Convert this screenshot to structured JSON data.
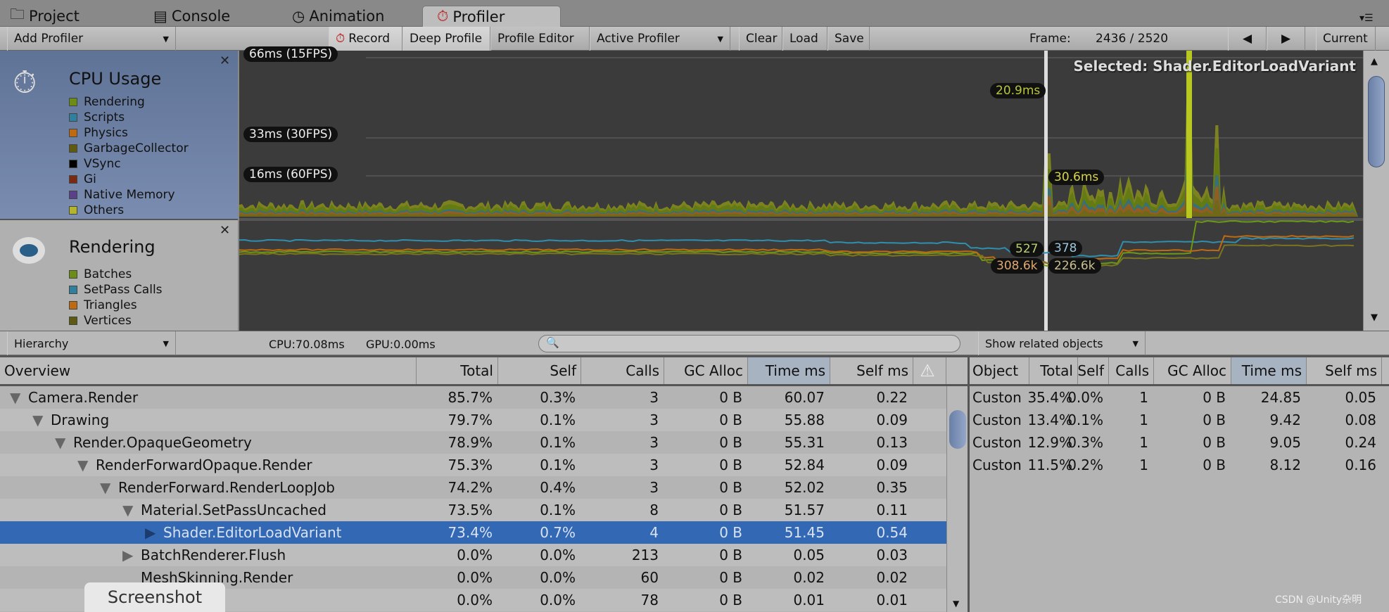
{
  "tabs": [
    {
      "label": "Project",
      "icon": "folder-icon"
    },
    {
      "label": "Console",
      "icon": "console-icon"
    },
    {
      "label": "Animation",
      "icon": "clock-icon"
    },
    {
      "label": "Profiler",
      "icon": "stopwatch-icon",
      "active": true
    }
  ],
  "toolbar": {
    "add_profiler": "Add Profiler",
    "record": "Record",
    "deep_profile": "Deep Profile",
    "profile_editor": "Profile Editor",
    "active_profiler": "Active Profiler",
    "clear": "Clear",
    "load": "Load",
    "save": "Save",
    "frame_label": "Frame:",
    "frame_value": "2436 / 2520",
    "current": "Current"
  },
  "cpu": {
    "title": "CPU Usage",
    "legend": [
      {
        "label": "Rendering",
        "color": "#6b8e12"
      },
      {
        "label": "Scripts",
        "color": "#2f7f9f"
      },
      {
        "label": "Physics",
        "color": "#c06a10"
      },
      {
        "label": "GarbageCollector",
        "color": "#5e5a10"
      },
      {
        "label": "VSync",
        "color": "#000000"
      },
      {
        "label": "Gi",
        "color": "#7a2a10"
      },
      {
        "label": "Native Memory",
        "color": "#5a3f8a"
      },
      {
        "label": "Others",
        "color": "#b3b52a"
      }
    ],
    "lines": [
      "66ms (15FPS)",
      "33ms (30FPS)",
      "16ms (60FPS)"
    ],
    "selected": "Selected: Shader.EditorLoadVariant",
    "value_a": "20.9ms",
    "value_b": "30.6ms"
  },
  "rendering": {
    "title": "Rendering",
    "legend": [
      {
        "label": "Batches",
        "color": "#6b8e12"
      },
      {
        "label": "SetPass Calls",
        "color": "#2f7f9f"
      },
      {
        "label": "Triangles",
        "color": "#c06a10"
      },
      {
        "label": "Vertices",
        "color": "#5e5a10"
      }
    ],
    "values": {
      "batches": "527",
      "setpass": "378",
      "triangles": "308.6k",
      "vertices": "226.6k"
    }
  },
  "hierarchy": {
    "mode": "Hierarchy",
    "cpu": "CPU:70.08ms",
    "gpu": "GPU:0.00ms",
    "search_placeholder": "",
    "related": "Show related objects",
    "columns": [
      "Overview",
      "Total",
      "Self",
      "Calls",
      "GC Alloc",
      "Time ms",
      "Self ms"
    ],
    "rows": [
      {
        "name": "Camera.Render",
        "depth": 0,
        "arrow": "down",
        "total": "85.7%",
        "self": "0.3%",
        "calls": "3",
        "gc": "0 B",
        "time": "60.07",
        "selfms": "0.22"
      },
      {
        "name": "Drawing",
        "depth": 1,
        "arrow": "down",
        "total": "79.7%",
        "self": "0.1%",
        "calls": "3",
        "gc": "0 B",
        "time": "55.88",
        "selfms": "0.09"
      },
      {
        "name": "Render.OpaqueGeometry",
        "depth": 2,
        "arrow": "down",
        "total": "78.9%",
        "self": "0.1%",
        "calls": "3",
        "gc": "0 B",
        "time": "55.31",
        "selfms": "0.13"
      },
      {
        "name": "RenderForwardOpaque.Render",
        "depth": 3,
        "arrow": "down",
        "total": "75.3%",
        "self": "0.1%",
        "calls": "3",
        "gc": "0 B",
        "time": "52.84",
        "selfms": "0.09"
      },
      {
        "name": "RenderForward.RenderLoopJob",
        "depth": 4,
        "arrow": "down",
        "total": "74.2%",
        "self": "0.4%",
        "calls": "3",
        "gc": "0 B",
        "time": "52.02",
        "selfms": "0.35"
      },
      {
        "name": "Material.SetPassUncached",
        "depth": 5,
        "arrow": "down",
        "total": "73.5%",
        "self": "0.1%",
        "calls": "8",
        "gc": "0 B",
        "time": "51.57",
        "selfms": "0.11"
      },
      {
        "name": "Shader.EditorLoadVariant",
        "depth": 6,
        "arrow": "right",
        "selected": true,
        "total": "73.4%",
        "self": "0.7%",
        "calls": "4",
        "gc": "0 B",
        "time": "51.45",
        "selfms": "0.54"
      },
      {
        "name": "BatchRenderer.Flush",
        "depth": 5,
        "arrow": "right",
        "total": "0.0%",
        "self": "0.0%",
        "calls": "213",
        "gc": "0 B",
        "time": "0.05",
        "selfms": "0.03"
      },
      {
        "name": "MeshSkinning.Render",
        "depth": 5,
        "arrow": "",
        "total": "0.0%",
        "self": "0.0%",
        "calls": "60",
        "gc": "0 B",
        "time": "0.02",
        "selfms": "0.02"
      },
      {
        "name": "ode.Render",
        "depth": 5,
        "arrow": "",
        "total": "0.0%",
        "self": "0.0%",
        "calls": "78",
        "gc": "0 B",
        "time": "0.01",
        "selfms": "0.01"
      }
    ]
  },
  "objects": {
    "columns": [
      "Object",
      "Total",
      "Self",
      "Calls",
      "GC Alloc",
      "Time ms",
      "Self ms"
    ],
    "rows": [
      [
        "Custon",
        "35.4%",
        "0.0%",
        "1",
        "0 B",
        "24.85",
        "0.05"
      ],
      [
        "Custon",
        "13.4%",
        "0.1%",
        "1",
        "0 B",
        "9.42",
        "0.08"
      ],
      [
        "Custon",
        "12.9%",
        "0.3%",
        "1",
        "0 B",
        "9.05",
        "0.24"
      ],
      [
        "Custon",
        "11.5%",
        "0.2%",
        "1",
        "0 B",
        "8.12",
        "0.16"
      ]
    ]
  },
  "tooltip": "Screenshot",
  "watermark": "CSDN @Unity杂明"
}
